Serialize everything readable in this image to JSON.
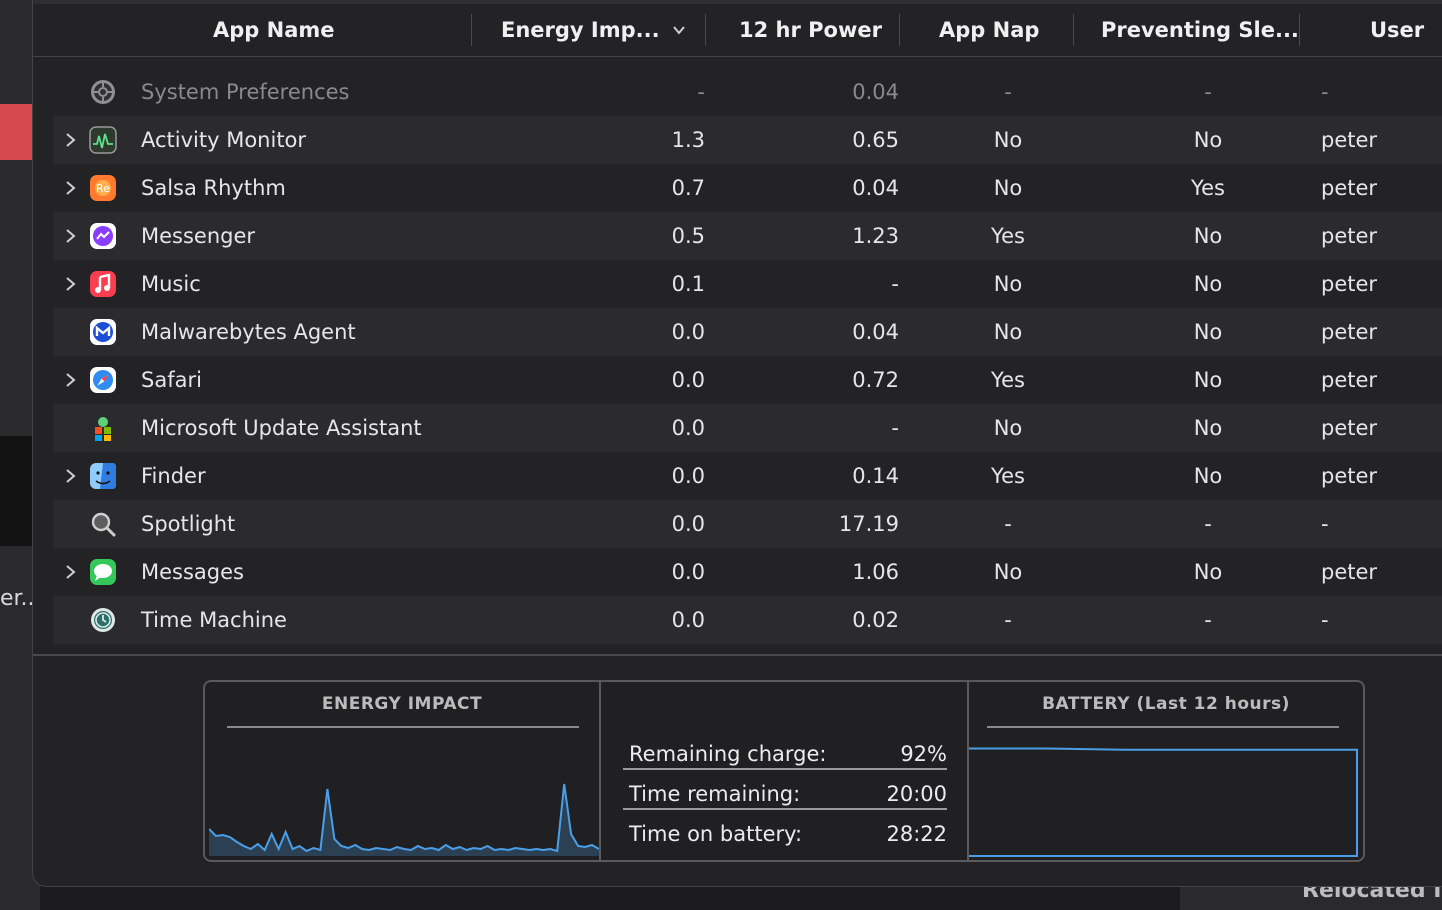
{
  "background": {
    "left_snippet": "er..",
    "corner_snippet": "Relocated I"
  },
  "header": {
    "columns": [
      {
        "label": "App Name"
      },
      {
        "label": "Energy Imp..."
      },
      {
        "label": "12 hr Power"
      },
      {
        "label": "App Nap"
      },
      {
        "label": "Preventing Sle..."
      },
      {
        "label": "User"
      }
    ],
    "sorted_column": "Energy Imp...",
    "sort_direction": "descending"
  },
  "rows": [
    {
      "name": "System Preferences",
      "energy": "-",
      "power": "0.04",
      "nap": "-",
      "prevent": "-",
      "user": "-",
      "expandable": false,
      "icon": "gear-icon",
      "dimmed": true
    },
    {
      "name": "Activity Monitor",
      "energy": "1.3",
      "power": "0.65",
      "nap": "No",
      "prevent": "No",
      "user": "peter",
      "expandable": true,
      "icon": "activity-monitor-icon"
    },
    {
      "name": "Salsa Rhythm",
      "energy": "0.7",
      "power": "0.04",
      "nap": "No",
      "prevent": "Yes",
      "user": "peter",
      "expandable": true,
      "icon": "salsa-rhythm-icon"
    },
    {
      "name": "Messenger",
      "energy": "0.5",
      "power": "1.23",
      "nap": "Yes",
      "prevent": "No",
      "user": "peter",
      "expandable": true,
      "icon": "messenger-icon"
    },
    {
      "name": "Music",
      "energy": "0.1",
      "power": "-",
      "nap": "No",
      "prevent": "No",
      "user": "peter",
      "expandable": true,
      "icon": "music-icon"
    },
    {
      "name": "Malwarebytes Agent",
      "energy": "0.0",
      "power": "0.04",
      "nap": "No",
      "prevent": "No",
      "user": "peter",
      "expandable": false,
      "icon": "malwarebytes-icon"
    },
    {
      "name": "Safari",
      "energy": "0.0",
      "power": "0.72",
      "nap": "Yes",
      "prevent": "No",
      "user": "peter",
      "expandable": true,
      "icon": "safari-compass-icon"
    },
    {
      "name": "Microsoft Update Assistant",
      "energy": "0.0",
      "power": "-",
      "nap": "No",
      "prevent": "No",
      "user": "peter",
      "expandable": false,
      "icon": "microsoft-update-icon"
    },
    {
      "name": "Finder",
      "energy": "0.0",
      "power": "0.14",
      "nap": "Yes",
      "prevent": "No",
      "user": "peter",
      "expandable": true,
      "icon": "finder-icon"
    },
    {
      "name": "Spotlight",
      "energy": "0.0",
      "power": "17.19",
      "nap": "-",
      "prevent": "-",
      "user": "-",
      "expandable": false,
      "icon": "magnifier-icon"
    },
    {
      "name": "Messages",
      "energy": "0.0",
      "power": "1.06",
      "nap": "No",
      "prevent": "No",
      "user": "peter",
      "expandable": true,
      "icon": "messages-bubble-icon"
    },
    {
      "name": "Time Machine",
      "energy": "0.0",
      "power": "0.02",
      "nap": "-",
      "prevent": "-",
      "user": "-",
      "expandable": false,
      "icon": "time-machine-icon"
    }
  ],
  "footer": {
    "energy_title": "ENERGY IMPACT",
    "battery_title": "BATTERY (Last 12 hours)",
    "stats": {
      "remaining_charge": {
        "label": "Remaining charge:",
        "value": "92%"
      },
      "time_remaining": {
        "label": "Time remaining:",
        "value": "20:00"
      },
      "time_on_battery": {
        "label": "Time on battery:",
        "value": "28:22"
      }
    },
    "energy_series": [
      0.25,
      0.18,
      0.19,
      0.17,
      0.12,
      0.08,
      0.05,
      0.1,
      0.04,
      0.2,
      0.05,
      0.22,
      0.05,
      0.08,
      0.03,
      0.06,
      0.04,
      0.65,
      0.15,
      0.08,
      0.06,
      0.09,
      0.05,
      0.04,
      0.06,
      0.05,
      0.04,
      0.07,
      0.05,
      0.04,
      0.08,
      0.05,
      0.06,
      0.04,
      0.09,
      0.05,
      0.07,
      0.04,
      0.06,
      0.05,
      0.08,
      0.04,
      0.05,
      0.04,
      0.06,
      0.05,
      0.04,
      0.05,
      0.04,
      0.05,
      0.03,
      0.7,
      0.2,
      0.08,
      0.07,
      0.09,
      0.05
    ],
    "battery_level": [
      0.93,
      0.93,
      0.92,
      0.92,
      0.92,
      0.92
    ],
    "accent_color": "#4a9fe8"
  }
}
